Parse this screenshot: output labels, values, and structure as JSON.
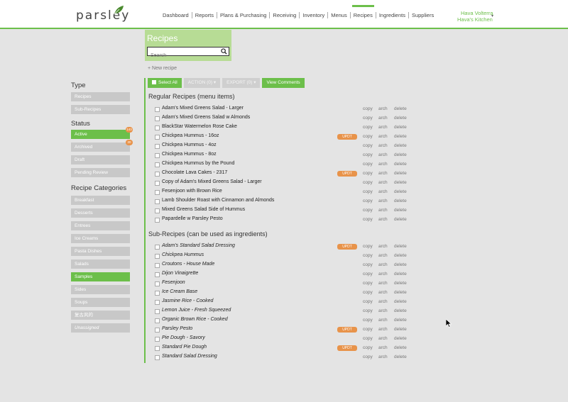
{
  "header": {
    "logo": "parsley",
    "nav": [
      "Dashboard",
      "Reports",
      "Plans & Purchasing",
      "Receiving",
      "Inventory",
      "Menus",
      "Recipes",
      "Ingredients",
      "Suppliers"
    ],
    "active_nav": "Recipes",
    "user_name": "Hava Volterra",
    "user_org": "Hava's Kitchen",
    "accent": "#6cbf4a"
  },
  "page": {
    "title": "Recipes",
    "search_placeholder": "Search",
    "new_recipe": "+ New recipe"
  },
  "toolbar": {
    "select_all": "Select All",
    "action": "ACTION (0)",
    "export": "EXPORT (0)",
    "view_comments": "View Comments"
  },
  "sidebar": {
    "type_heading": "Type",
    "types": [
      "Recipes",
      "Sub-Recipes"
    ],
    "status_heading": "Status",
    "statuses": [
      {
        "label": "Active",
        "badge": "143"
      },
      {
        "label": "Archived",
        "badge": "20"
      },
      {
        "label": "Draft",
        "badge": ""
      },
      {
        "label": "Pending Review",
        "badge": ""
      }
    ],
    "categories_heading": "Recipe Categories",
    "categories": [
      "Breakfast",
      "Desserts",
      "Entrees",
      "Ice Creams",
      "Pasta Dishes",
      "Salads",
      "Samples",
      "Sides",
      "Soups",
      "复古风的",
      "Unassigned"
    ],
    "selected_category": "Samples"
  },
  "regular": {
    "heading": "Regular Recipes (menu items)",
    "items": [
      {
        "name": "Adam's Mixed Greens Salad - Larger",
        "updt": false
      },
      {
        "name": "Adam's Mixed Greens Salad w Almonds",
        "updt": false
      },
      {
        "name": "BlackStar Watermelon Rose Cake",
        "updt": false
      },
      {
        "name": "Chickpea Hummus - 16oz",
        "updt": true
      },
      {
        "name": "Chickpea Hummus - 4oz",
        "updt": false
      },
      {
        "name": "Chickpea Hummus - 8oz",
        "updt": false
      },
      {
        "name": "Chickpea Hummus by the Pound",
        "updt": false
      },
      {
        "name": "Chocolate Lava Cakes - 2317",
        "updt": true
      },
      {
        "name": "Copy of Adam's Mixed Greens Salad - Larger",
        "updt": false
      },
      {
        "name": "Fesenjoon with Brown Rice",
        "updt": false
      },
      {
        "name": "Lamb Shoulder Roast with Cinnamon and Almonds",
        "updt": false
      },
      {
        "name": "Mixed Greens Salad Side of Hummus",
        "updt": false
      },
      {
        "name": "Papardelle w Parsley Pesto",
        "updt": false
      }
    ]
  },
  "subrecipes": {
    "heading": "Sub-Recipes (can be used as ingredients)",
    "items": [
      {
        "name": "Adam's Standard Salad Dressing",
        "updt": true
      },
      {
        "name": "Chickpea Hummus",
        "updt": false
      },
      {
        "name": "Croutons - House Made",
        "updt": false
      },
      {
        "name": "Dijon Vinaigrette",
        "updt": false
      },
      {
        "name": "Fesenjoon",
        "updt": false
      },
      {
        "name": "Ice Cream Base",
        "updt": false
      },
      {
        "name": "Jasmine Rice - Cooked",
        "updt": false
      },
      {
        "name": "Lemon Juice - Fresh Squeezed",
        "updt": false
      },
      {
        "name": "Organic Brown Rice - Cooked",
        "updt": false
      },
      {
        "name": "Parsley Pesto",
        "updt": true
      },
      {
        "name": "Pie Dough - Savory",
        "updt": false
      },
      {
        "name": "Standard Pie Dough",
        "updt": true
      },
      {
        "name": "Standard Salad Dressing",
        "updt": false
      }
    ]
  },
  "row_actions": {
    "copy": "copy",
    "arch": "arch",
    "delete": "delete",
    "updt": "UPDT"
  }
}
